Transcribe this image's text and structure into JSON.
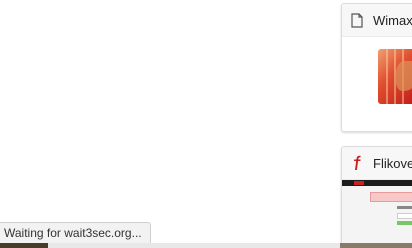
{
  "status": {
    "text": "Waiting for wait3sec.org..."
  },
  "cards": [
    {
      "title": "Wimax",
      "icon": "document-icon"
    },
    {
      "title": "Flikover",
      "icon": "flickr-f-icon",
      "icon_color": "#c8201e"
    }
  ]
}
